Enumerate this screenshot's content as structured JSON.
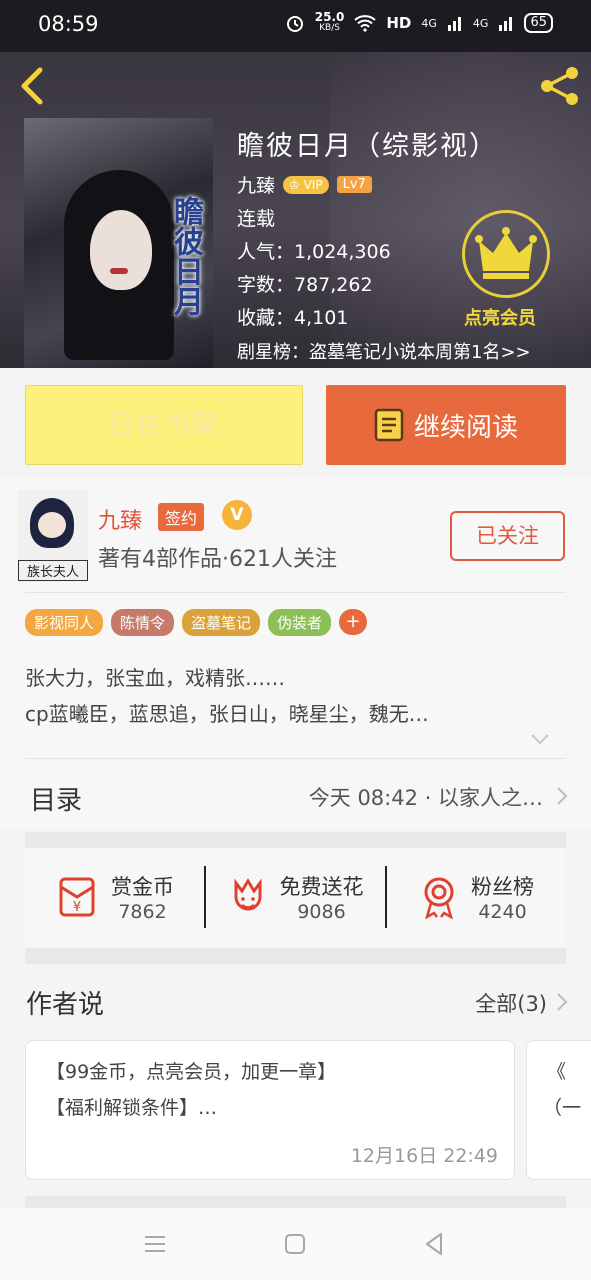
{
  "status_bar": {
    "time": "08:59",
    "net_speed": "25.0",
    "net_unit": "KB/S",
    "hd": "HD",
    "signal1": "4G",
    "signal2": "4G",
    "battery": "65"
  },
  "book": {
    "title": "瞻彼日月（综影视）",
    "cover_title": "瞻彼日月",
    "author": "九臻",
    "vip_badge": "VIP",
    "level_badge": "Lv7",
    "status": "连载",
    "popularity": "人气：1,024,306",
    "word_count": "字数：787,262",
    "favorites": "收藏：4,101",
    "ranking": "剧星榜：盗墓笔记小说本周第1名>>",
    "crown_label": "点亮会员"
  },
  "actions": {
    "shelf_label": "已在书架",
    "read_label": "继续阅读"
  },
  "author_card": {
    "avatar_caption": "族长夫人",
    "name": "九臻",
    "sign_tag": "签约",
    "v_badge": "V",
    "stats": "著有4部作品·621人关注",
    "follow_label": "已关注"
  },
  "tags": [
    {
      "label": "影视同人",
      "color": "#f4a640"
    },
    {
      "label": "陈情令",
      "color": "#c57a6a"
    },
    {
      "label": "盗墓笔记",
      "color": "#d9a33a"
    },
    {
      "label": "伪装者",
      "color": "#8cbf55"
    }
  ],
  "tag_add": "+",
  "description": {
    "line1": "张大力，张宝血，戏精张……",
    "line2": "cp蓝曦臣，蓝思追，张日山，晓星尘，魏无…"
  },
  "toc": {
    "label": "目录",
    "latest": "今天 08:42 · 以家人之…"
  },
  "rewards": [
    {
      "label": "赏金币",
      "value": "7862",
      "icon": "red-envelope-icon"
    },
    {
      "label": "免费送花",
      "value": "9086",
      "icon": "flower-icon"
    },
    {
      "label": "粉丝榜",
      "value": "4240",
      "icon": "medal-icon"
    }
  ],
  "author_says": {
    "title": "作者说",
    "all_label": "全部(3)",
    "note_line1": "【99金币，点亮会员，加更一章】",
    "note_line2": "【福利解锁条件】…",
    "note_time": "12月16日  22:49",
    "peek_line1": "《",
    "peek_line2": "（一"
  },
  "colors": {
    "accent_orange": "#e8693c",
    "shelf_yellow": "#fdf07b",
    "crown_gold": "#e9cf37",
    "link_red": "#e05a3e"
  }
}
